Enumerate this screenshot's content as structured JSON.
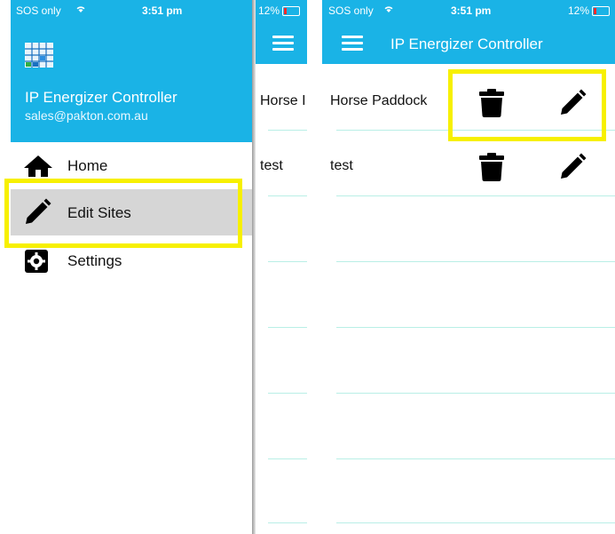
{
  "left_phone": {
    "status": {
      "carrier": "SOS only",
      "time": "3:51 pm"
    },
    "drawer": {
      "app_title": "IP Energizer Controller",
      "email": "sales@pakton.com.au",
      "items": [
        {
          "label": "Home",
          "icon": "home-icon"
        },
        {
          "label": "Edit Sites",
          "icon": "pencil-icon",
          "selected": true
        },
        {
          "label": "Settings",
          "icon": "gear-icon"
        }
      ]
    },
    "peek": {
      "battery": "12%",
      "rows": [
        "Horse I",
        "test"
      ]
    }
  },
  "right_phone": {
    "status": {
      "carrier": "SOS only",
      "time": "3:51 pm",
      "battery": "12%"
    },
    "header": {
      "title": "IP Energizer Controller"
    },
    "sites": [
      {
        "name": "Horse Paddock"
      },
      {
        "name": "test"
      }
    ]
  },
  "colors": {
    "header_blue": "#1ab3e6",
    "highlight_yellow": "#f7f000",
    "separator": "#b9efe6"
  }
}
